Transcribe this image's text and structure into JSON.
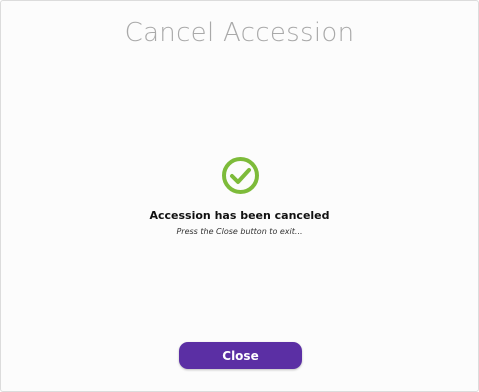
{
  "dialog": {
    "title": "Cancel Accession",
    "status_icon": "check-circle-icon",
    "message": "Accession has been canceled",
    "submessage": "Press the Close button to exit...",
    "close_label": "Close"
  },
  "colors": {
    "success": "#7dbb3a",
    "button": "#5b2fa4",
    "title": "#a9a9a9"
  }
}
